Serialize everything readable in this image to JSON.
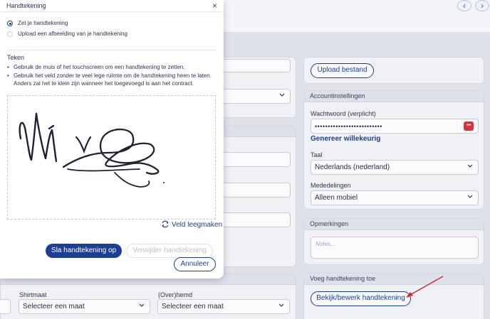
{
  "modal": {
    "title": "Handtekening",
    "close_icon": "×",
    "options": [
      {
        "label": "Zet je handtekening",
        "selected": true
      },
      {
        "label": "Upload een afbeelding van je handtekening",
        "selected": false
      }
    ],
    "section_title": "Teken",
    "instructions": [
      "Gebruik de muis of het touchscreen om een handtekening te zetten.",
      "Gebruik het veld zonder te veel lege ruimte om de handtekening heen te laten.",
      "Anders zal het te klein zijn wanneer het toegevoegd is aan het contract."
    ],
    "clear_label": "Veld leegmaken",
    "save_label": "Sla handtekening op",
    "remove_label": "Verwijder handtekening",
    "cancel_label": "Annuleer"
  },
  "nav": {
    "prev": "‹",
    "next": "›"
  },
  "right_panel": {
    "upload_label": "Upload bestand",
    "account_header": "Accountinstellingen",
    "password_label": "Wachtwoord (verplicht)",
    "password_value": "••••••••••••••••••••••••••",
    "password_badge": "•••",
    "generate_label": "Genereer willekeurig",
    "language_label": "Taal",
    "language_value": "Nederlands (nederland)",
    "notifications_label": "Mededelingen",
    "notifications_value": "Alleen mobiel",
    "remarks_header": "Opmerkingen",
    "notes_placeholder": "Notes...",
    "signature_header": "Voeg handtekening toe",
    "view_signature_label": "Bekijk/bewerk handtekening"
  },
  "bottom_fields": {
    "shirt_label": "Shirtmaat",
    "shirt_value": "Selecteer een maat",
    "overhemd_label": "(Over)hemd",
    "overhemd_value": "Selecteer een maat"
  },
  "colors": {
    "accent": "#1c3f96",
    "danger": "#d9323c",
    "arrow": "#d9262c"
  }
}
